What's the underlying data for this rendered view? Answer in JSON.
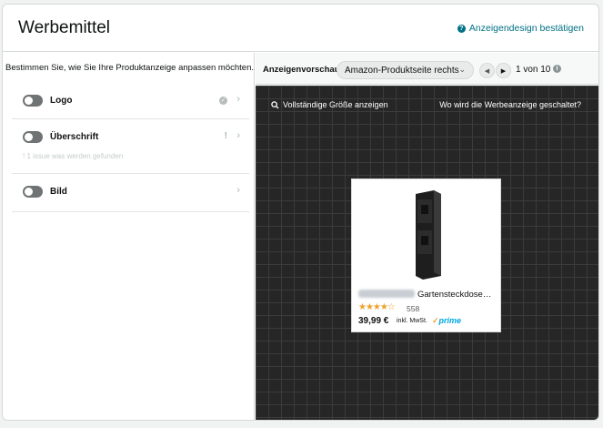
{
  "header": {
    "title": "Werbemittel",
    "confirm_label": "Anzeigendesign bestätigen"
  },
  "left": {
    "instruction": "Bestimmen Sie, wie Sie Ihre Produktanzeige anpassen möchten.",
    "options": [
      {
        "label": "Logo",
        "status": "check",
        "enabled": false
      },
      {
        "label": "Überschrift",
        "status": "!",
        "issue": "! 1 issue was werden gefunden",
        "enabled": false
      },
      {
        "label": "Bild",
        "status": "",
        "enabled": false
      }
    ]
  },
  "preview": {
    "label": "Anzeigenvorschau",
    "placement_selected": "Amazon-Produktseite rechts",
    "page_indicator": "1 von 10",
    "fullsize_label": "Vollständige Größe anzeigen",
    "where_label": "Wo wird die Werbeanzeige geschaltet?"
  },
  "ad": {
    "title": "Gartensteckdose…",
    "stars": "★★★★☆",
    "rating_count": "558",
    "price": "39,99 €",
    "tax_note": "inkl. MwSt.",
    "prime_label": "prime"
  },
  "icons": {
    "confirm": "question-circle-icon",
    "info": "info-circle-icon",
    "search": "magnifier-icon",
    "chevron": "chevron-right-icon"
  },
  "colors": {
    "link": "#007185",
    "stage_bg": "#262626",
    "star": "#f0a12a",
    "prime": "#00a8e1"
  }
}
